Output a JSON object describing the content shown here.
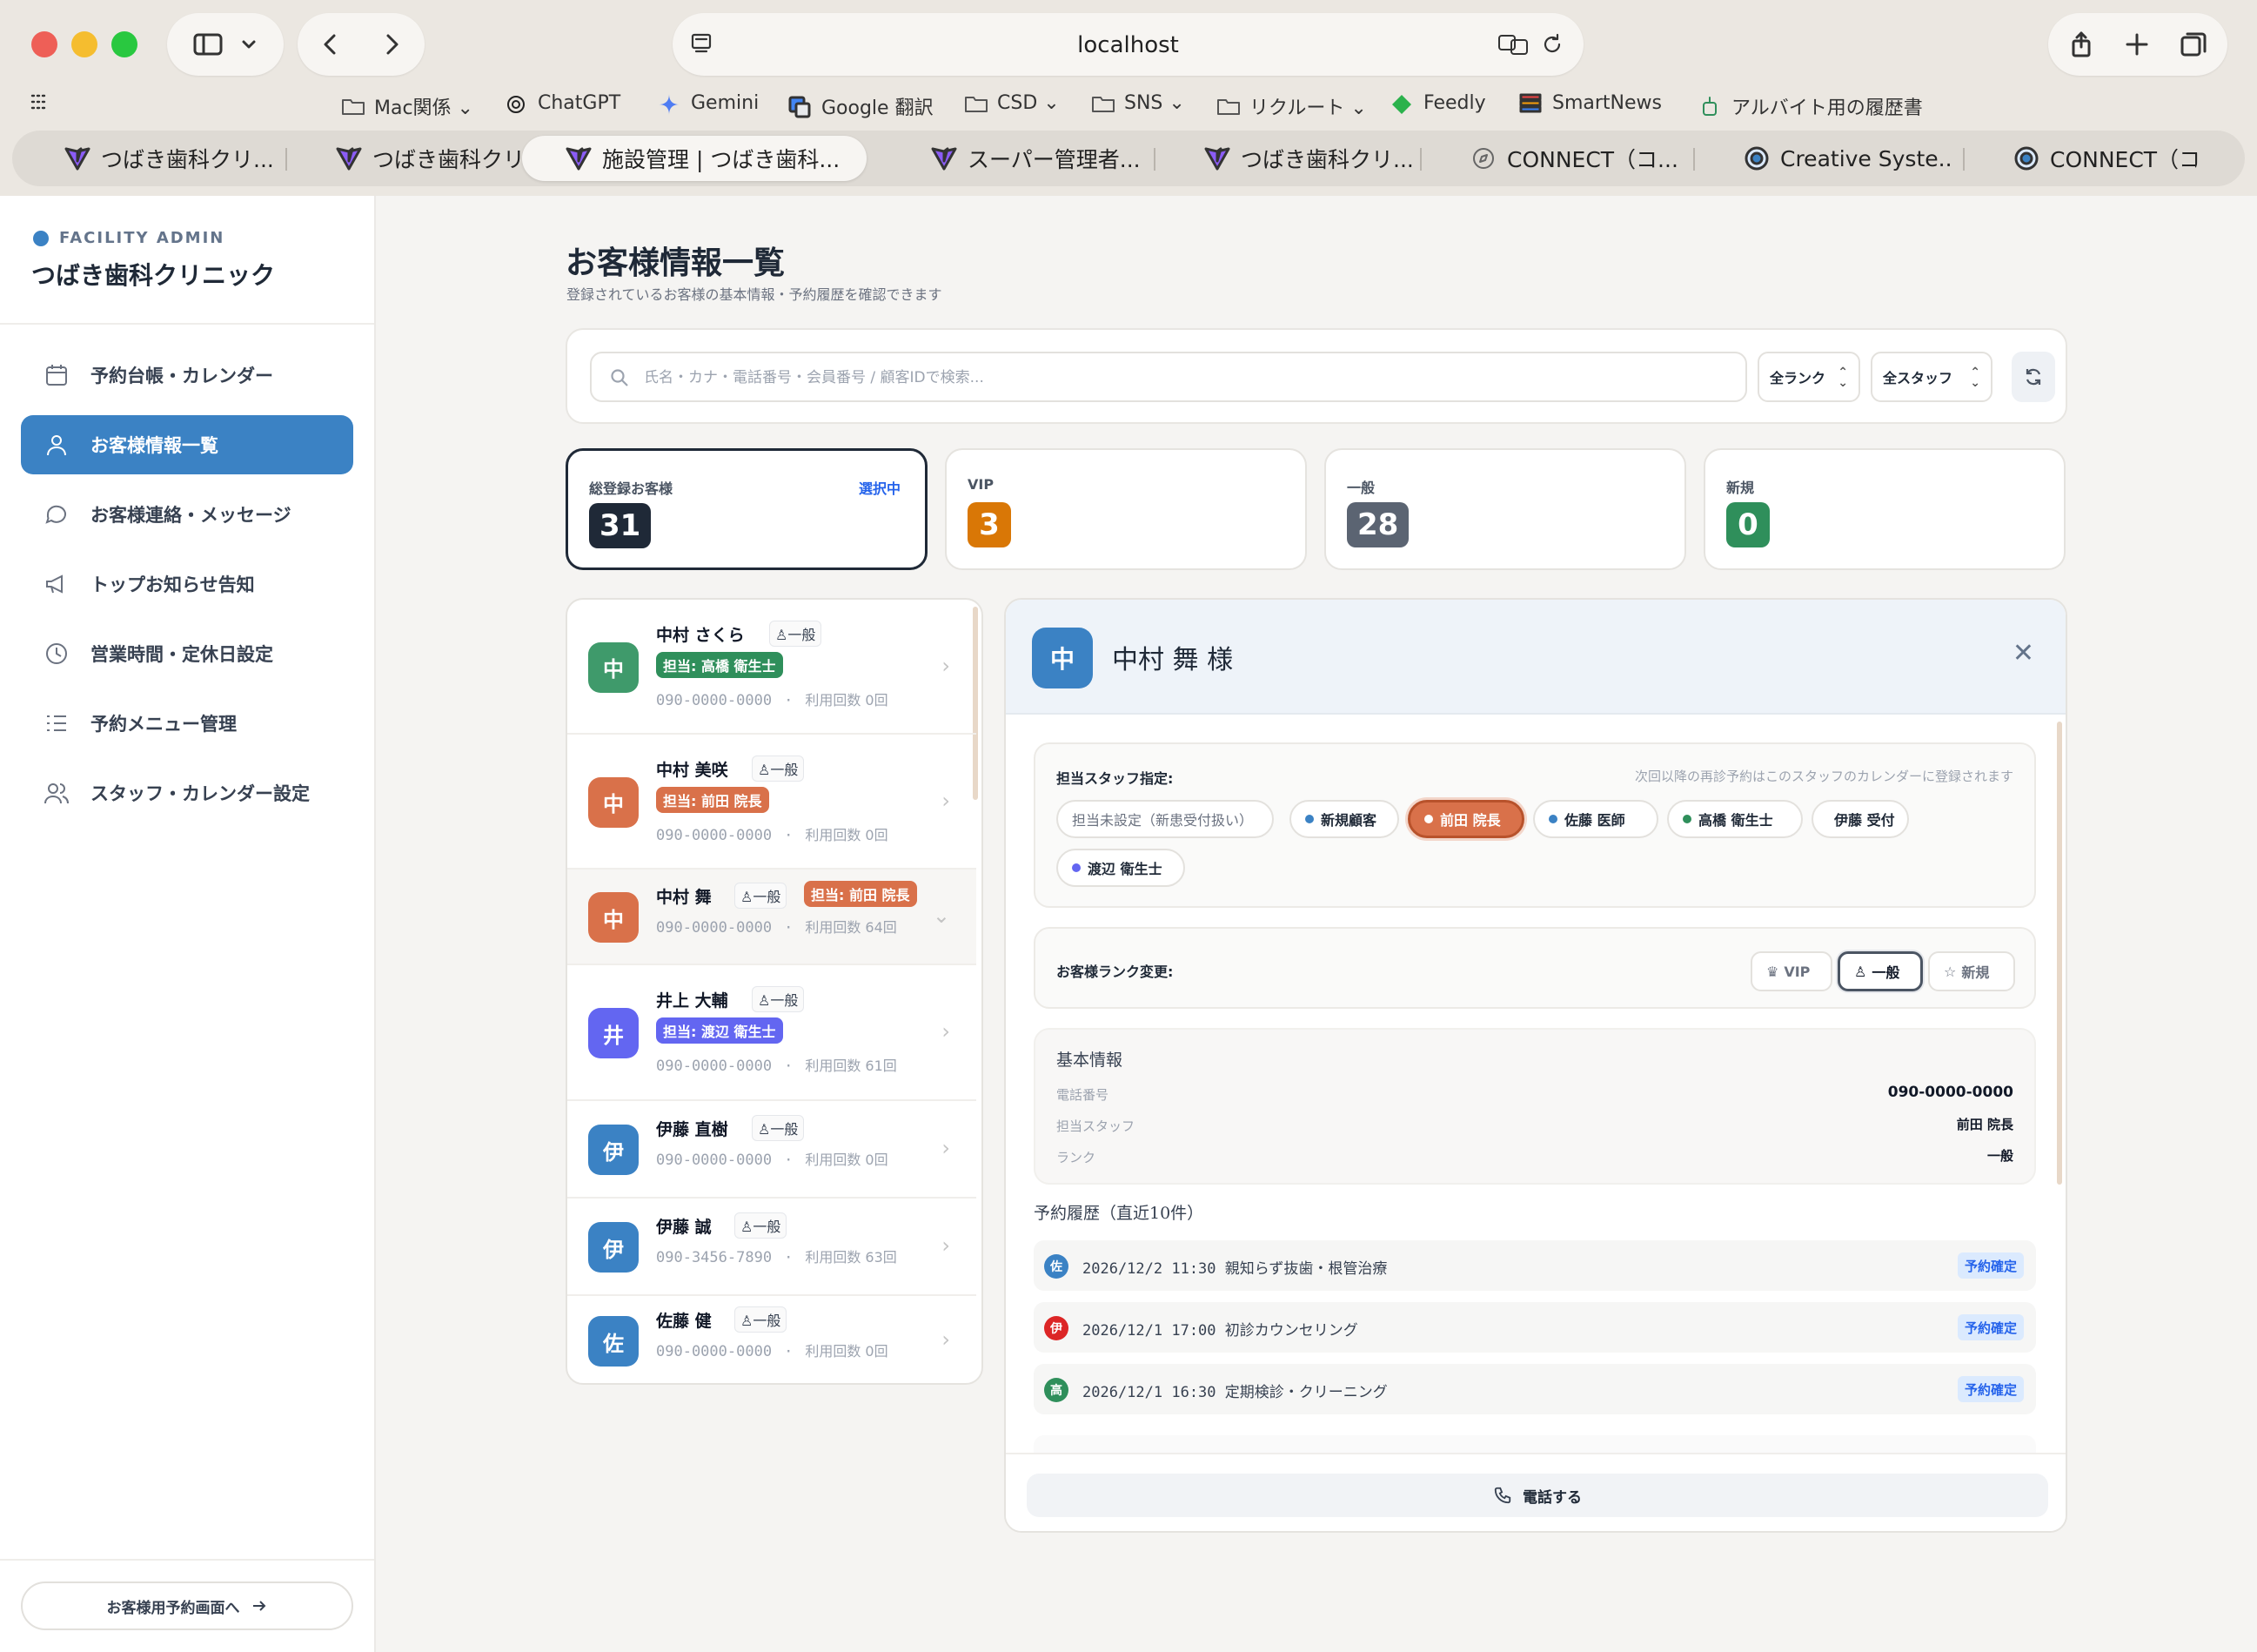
{
  "browser": {
    "url": "localhost",
    "bookmarks": [
      {
        "label": "Mac関係",
        "icon": "folder-icon",
        "chev": true
      },
      {
        "label": "ChatGPT",
        "icon": "chatgpt-icon",
        "chev": false
      },
      {
        "label": "Gemini",
        "icon": "gemini-icon",
        "chev": false
      },
      {
        "label": "Google 翻訳",
        "icon": "translate-icon",
        "chev": false
      },
      {
        "label": "CSD",
        "icon": "folder-icon",
        "chev": true
      },
      {
        "label": "SNS",
        "icon": "folder-icon",
        "chev": true
      },
      {
        "label": "リクルート",
        "icon": "folder-icon",
        "chev": true
      },
      {
        "label": "Feedly",
        "icon": "feedly-icon",
        "chev": false
      },
      {
        "label": "SmartNews",
        "icon": "smartnews-icon",
        "chev": false
      },
      {
        "label": "アルバイト用の履歴書",
        "icon": "robot-icon",
        "chev": false
      }
    ],
    "tabs": [
      {
        "label": "つばき歯科クリ...",
        "icon": "vite-icon",
        "active": false
      },
      {
        "label": "つばき歯科クリ...",
        "icon": "vite-icon",
        "active": false
      },
      {
        "label": "施設管理 | つばき歯科...",
        "icon": "vite-icon",
        "active": true
      },
      {
        "label": "スーパー管理者...",
        "icon": "vite-icon",
        "active": false
      },
      {
        "label": "つばき歯科クリ...",
        "icon": "vite-icon",
        "active": false
      },
      {
        "label": "CONNECT（コ...",
        "icon": "compass-icon",
        "active": false
      },
      {
        "label": "Creative Syste...",
        "icon": "csd-icon",
        "active": false
      },
      {
        "label": "CONNECT（コ...",
        "icon": "csd-icon",
        "active": false
      }
    ]
  },
  "sidebar": {
    "tag": "FACILITY ADMIN",
    "clinic": "つばき歯科クリニック",
    "items": [
      {
        "label": "予約台帳・カレンダー",
        "icon": "calendar-icon",
        "active": false
      },
      {
        "label": "お客様情報一覧",
        "icon": "user-icon",
        "active": true
      },
      {
        "label": "お客様連絡・メッセージ",
        "icon": "chat-icon",
        "active": false
      },
      {
        "label": "トップお知らせ告知",
        "icon": "megaphone-icon",
        "active": false
      },
      {
        "label": "営業時間・定休日設定",
        "icon": "clock-icon",
        "active": false
      },
      {
        "label": "予約メニュー管理",
        "icon": "list-icon",
        "active": false
      },
      {
        "label": "スタッフ・カレンダー設定",
        "icon": "users-icon",
        "active": false
      }
    ],
    "customer_link": "お客様用予約画面へ"
  },
  "page": {
    "title": "お客様情報一覧",
    "subtitle": "登録されているお客様の基本情報・予約履歴を確認できます"
  },
  "search": {
    "placeholder": "氏名・カナ・電話番号・会員番号 / 顧客IDで検索...",
    "rank_filter": "全ランク",
    "staff_filter": "全スタッフ"
  },
  "stats": [
    {
      "label": "総登録お客様",
      "value": "31",
      "color": "#1f2937",
      "chip": "選択中"
    },
    {
      "label": "VIP",
      "value": "3",
      "color": "#d97706",
      "chip": ""
    },
    {
      "label": "一般",
      "value": "28",
      "color": "#5b6472",
      "chip": ""
    },
    {
      "label": "新規",
      "value": "0",
      "color": "#2f8f5b",
      "chip": ""
    }
  ],
  "customers": [
    {
      "initial": "中",
      "name": "中村 さくら",
      "rank": "一般",
      "staff": "担当: 高橋 衛生士",
      "staff_color": "#2f8f5b",
      "avatar_color": "#3f9a6b",
      "phone": "090-0000-0000",
      "visits": "利用回数 0回"
    },
    {
      "initial": "中",
      "name": "中村 美咲",
      "rank": "一般",
      "staff": "担当: 前田 院長",
      "staff_color": "#d9714a",
      "avatar_color": "#d9714a",
      "phone": "090-0000-0000",
      "visits": "利用回数 0回"
    },
    {
      "initial": "中",
      "name": "中村 舞",
      "rank": "一般",
      "staff": "担当: 前田 院長",
      "staff_color": "#d9714a",
      "avatar_color": "#d9714a",
      "phone": "090-0000-0000",
      "visits": "利用回数 64回"
    },
    {
      "initial": "井",
      "name": "井上 大輔",
      "rank": "一般",
      "staff": "担当: 渡辺 衛生士",
      "staff_color": "#6366f1",
      "avatar_color": "#6366f1",
      "phone": "090-0000-0000",
      "visits": "利用回数 61回"
    },
    {
      "initial": "伊",
      "name": "伊藤 直樹",
      "rank": "一般",
      "staff": "",
      "staff_color": "",
      "avatar_color": "#3b82c4",
      "phone": "090-0000-0000",
      "visits": "利用回数 0回"
    },
    {
      "initial": "伊",
      "name": "伊藤 誠",
      "rank": "一般",
      "staff": "",
      "staff_color": "",
      "avatar_color": "#3b82c4",
      "phone": "090-3456-7890",
      "visits": "利用回数 63回"
    },
    {
      "initial": "佐",
      "name": "佐藤 健",
      "rank": "一般",
      "staff": "",
      "staff_color": "",
      "avatar_color": "#3b82c4",
      "phone": "090-0000-0000",
      "visits": "利用回数 0回"
    }
  ],
  "detail": {
    "initial": "中",
    "name": "中村 舞 様",
    "staff_section": {
      "title": "担当スタッフ指定:",
      "note": "次回以降の再診予約はこのスタッフのカレンダーに登録されます",
      "options": [
        {
          "label": "担当未設定（新患受付扱い）",
          "dot": "",
          "active": false
        },
        {
          "label": "新規顧客",
          "dot": "#3b82c4",
          "active": false
        },
        {
          "label": "前田 院長",
          "dot": "#ffffff",
          "active": true
        },
        {
          "label": "佐藤 医師",
          "dot": "#3b82c4",
          "active": false
        },
        {
          "label": "高橋 衛生士",
          "dot": "#2f8f5b",
          "active": false
        },
        {
          "label": "伊藤 受付",
          "dot": "#dc2626",
          "active": false
        },
        {
          "label": "渡辺 衛生士",
          "dot": "#6366f1",
          "active": false
        }
      ]
    },
    "rank_section": {
      "title": "お客様ランク変更:",
      "options": [
        {
          "label": "VIP",
          "icon": "crown-icon",
          "active": false
        },
        {
          "label": "一般",
          "icon": "user-icon",
          "active": true
        },
        {
          "label": "新規",
          "icon": "star-icon",
          "active": false
        }
      ]
    },
    "basic": {
      "title": "基本情報",
      "rows": [
        {
          "key": "電話番号",
          "value": "090-0000-0000"
        },
        {
          "key": "担当スタッフ",
          "value": "前田 院長"
        },
        {
          "key": "ランク",
          "value": "一般"
        }
      ]
    },
    "history_title": "予約履歴（直近10件）",
    "history": [
      {
        "initial": "佐",
        "color": "#3b82c4",
        "text": "2026/12/2 11:30  親知らず抜歯・根管治療",
        "status": "予約確定"
      },
      {
        "initial": "伊",
        "color": "#dc2626",
        "text": "2026/12/1 17:00  初診カウンセリング",
        "status": "予約確定"
      },
      {
        "initial": "高",
        "color": "#2f8f5b",
        "text": "2026/12/1 16:30  定期検診・クリーニング",
        "status": "予約確定"
      }
    ],
    "call_label": "電話する"
  }
}
